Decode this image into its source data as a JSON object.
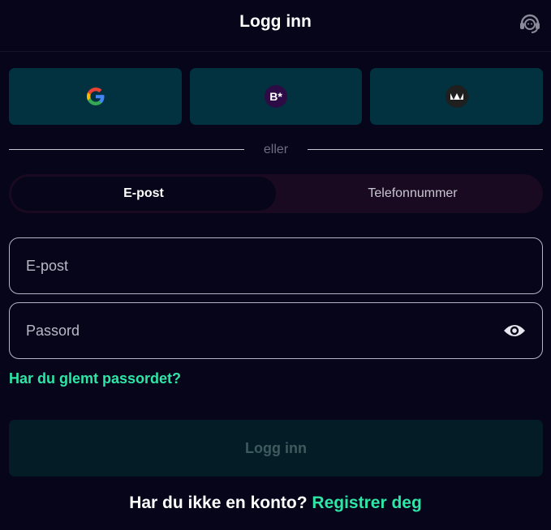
{
  "header": {
    "title": "Logg inn",
    "support_icon": "headset-icon"
  },
  "social": [
    {
      "name": "google",
      "icon": "google-g-icon",
      "badge_text": ""
    },
    {
      "name": "bankid-star",
      "icon": "b-star-icon",
      "badge_text": "B*"
    },
    {
      "name": "vipps",
      "icon": "vipps-icon",
      "badge_text": ""
    }
  ],
  "divider": {
    "text": "eller"
  },
  "tabs": [
    {
      "label": "E-post",
      "active": true
    },
    {
      "label": "Telefonnummer",
      "active": false
    }
  ],
  "form": {
    "email_placeholder": "E-post",
    "password_placeholder": "Passord",
    "show_password_icon": "eye-icon",
    "forgot_label": "Har du glemt passordet?",
    "submit_label": "Logg inn"
  },
  "signup": {
    "question": "Har du ikke en konto? ",
    "link": "Registrer deg"
  },
  "colors": {
    "background": "#06051a",
    "accent": "#2ee6a6",
    "social_button": "#023140",
    "submit_disabled": "#031c25"
  }
}
